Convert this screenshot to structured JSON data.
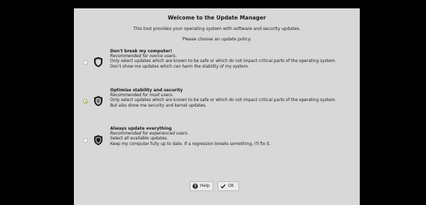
{
  "dialog": {
    "title": "Welcome to the Update Manager",
    "subtitle_1": "This tool provides your operating system with software and security updates.",
    "subtitle_2": "Please choose an update policy."
  },
  "options": [
    {
      "title": "Don't break my computer!",
      "recommended": "Recommended for novice users.",
      "line_1": "Only select updates which are known to be safe or which do not impact critical parts of the operating system.",
      "line_2": "Don't show me updates which can harm the stability of my system.",
      "selected": false,
      "icon": "shield-outline-icon"
    },
    {
      "title": "Optimise stability and security",
      "recommended": "Recommended for most users.",
      "line_1": "Only select updates which are known to be safe or which do not impact critical parts of the operating system.",
      "line_2": "But also show me security and kernel updates.",
      "selected": true,
      "icon": "shield-half-icon"
    },
    {
      "title": "Always update everything",
      "recommended": "Recommended for experienced users.",
      "line_1": "Select all available updates.",
      "line_2": "Keep my computer fully up to date. If a regression breaks something, I'll fix it.",
      "selected": false,
      "icon": "shield-filled-icon"
    }
  ],
  "buttons": {
    "help_label": "Help",
    "ok_label": "OK",
    "help_icon": "help-icon",
    "ok_icon": "checkmark-icon"
  },
  "colors": {
    "background": "#000000",
    "dialog_bg": "#d8d8d8",
    "accent": "#8fae48"
  }
}
